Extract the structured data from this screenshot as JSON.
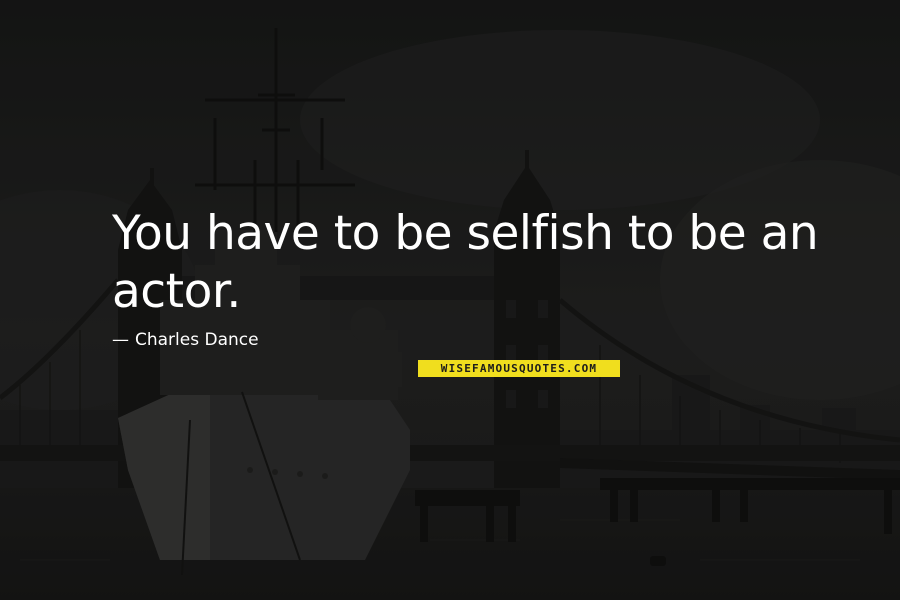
{
  "quote": {
    "text": "You have to be selfish to be an actor.",
    "author_dash": "—",
    "author": "Charles Dance"
  },
  "watermark": {
    "text": "WISEFAMOUSQUOTES.COM"
  },
  "colors": {
    "background": "#2a2a29",
    "text": "#ffffff",
    "watermark_background": "#f0de1e",
    "watermark_text": "#1d1d1b"
  }
}
